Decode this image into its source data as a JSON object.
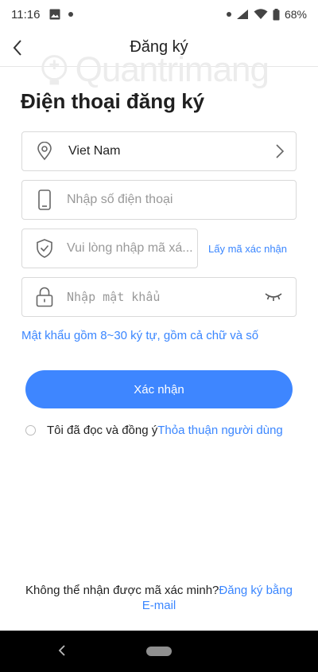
{
  "status_bar": {
    "time": "11:16",
    "battery": "68%",
    "left_icons": [
      "image-icon",
      "dot-icon"
    ],
    "right_icons": [
      "dot-icon",
      "wifi-icon",
      "signal-icon",
      "battery-icon"
    ]
  },
  "header": {
    "title": "Đăng ký",
    "back_icon": "chevron-left-icon"
  },
  "watermark": {
    "text": "Quantrimang"
  },
  "page_title": "Điện thoại đăng ký",
  "form": {
    "country": {
      "value": "Viet Nam",
      "icon": "location-pin-icon",
      "chevron": "chevron-right-icon"
    },
    "phone": {
      "placeholder": "Nhập số điện thoại",
      "icon": "phone-icon"
    },
    "code": {
      "placeholder": "Vui lòng nhập mã xá...",
      "icon": "shield-check-icon",
      "get_code_label": "Lấy mã xác nhận"
    },
    "password": {
      "placeholder": "Nhập mật khẩu",
      "icon": "lock-icon",
      "toggle_icon": "eye-closed-icon"
    }
  },
  "hint": "Mật khẩu gồm 8~30 ký tự, gồm cả chữ và số",
  "confirm_label": "Xác nhận",
  "agreement": {
    "text": "Tôi đã đọc và đồng ý",
    "link": "Thỏa thuận người dùng"
  },
  "footer": {
    "text": "Không thể nhận được mã xác minh?",
    "link_part1": "Đăng ký bằng",
    "link_part2": "E-mail"
  },
  "colors": {
    "accent": "#3e86ff",
    "link": "#3a86ff",
    "border": "#d9d9d9"
  }
}
